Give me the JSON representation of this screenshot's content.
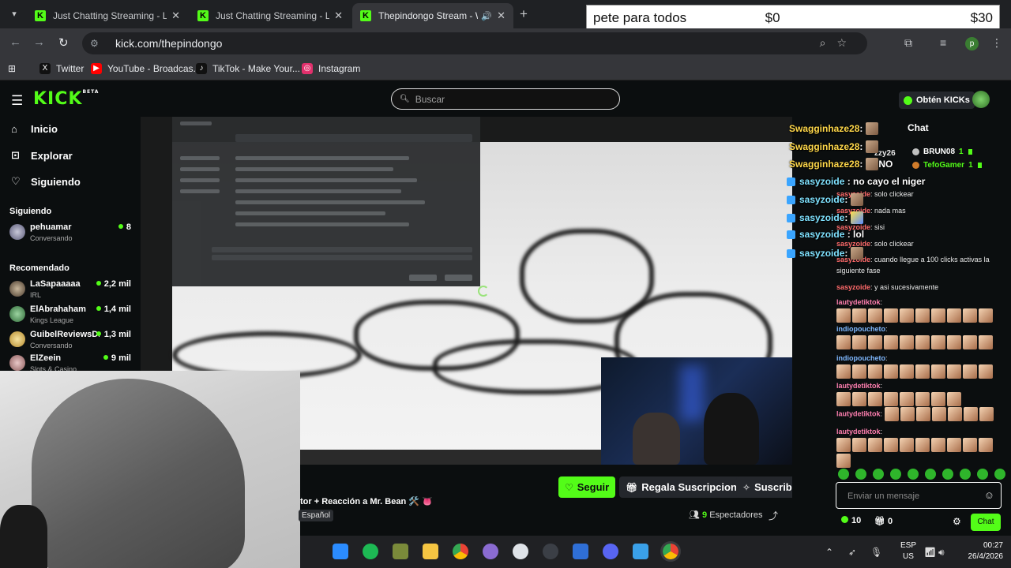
{
  "tabs": [
    {
      "title": "Just Chatting Streaming - Live S"
    },
    {
      "title": "Just Chatting Streaming - Live S"
    },
    {
      "title": "Thepindongo Stream - Watc"
    }
  ],
  "counter": {
    "name": "pete para todos",
    "value1": "$0",
    "value2": "$30"
  },
  "address": {
    "url": "kick.com/thepindongo"
  },
  "profile_initial": "p",
  "bookmarks": [
    {
      "label": "Twitter",
      "color": "#111111"
    },
    {
      "label": "YouTube - Broadcas...",
      "color": "#ff0000"
    },
    {
      "label": "TikTok - Make Your...",
      "color": "#111111"
    },
    {
      "label": "Instagram",
      "color": "#e1306c"
    }
  ],
  "kick": {
    "logo": "KICK",
    "logo_beta": "BETA",
    "search_placeholder": "Buscar",
    "kicks_button": "Obtén KICKs"
  },
  "sidebar": {
    "nav": [
      {
        "label": "Inicio",
        "icon": "home-icon"
      },
      {
        "label": "Explorar",
        "icon": "compass-icon"
      },
      {
        "label": "Siguiendo",
        "icon": "heart-icon"
      }
    ],
    "following_header": "Siguiendo",
    "following": [
      {
        "name": "pehuamar",
        "category": "Conversando",
        "viewers": "8"
      }
    ],
    "recommended_header": "Recomendado",
    "recommended": [
      {
        "name": "LaSapaaaaa",
        "category": "IRL",
        "viewers": "2,2 mil"
      },
      {
        "name": "ElAbrahaham",
        "category": "Kings League",
        "viewers": "1,4 mil"
      },
      {
        "name": "GuibelReviewsD...",
        "category": "Conversando",
        "viewers": "1,3 mil"
      },
      {
        "name": "ElZeein",
        "category": "Slots & Casino",
        "viewers": "9 mil"
      }
    ]
  },
  "stream": {
    "title": "tor + Reacción a Mr. Bean 🛠️ 👅",
    "language": "Español",
    "follow": "Seguir",
    "gift": "Regala Suscripciones",
    "subscribe": "Suscribirse",
    "viewers_count": "9",
    "viewers_label": "Espectadores"
  },
  "overlay_chat": [
    {
      "user": "Swagginhaze28",
      "text": ""
    },
    {
      "user": "Swagginhaze28",
      "text": ""
    },
    {
      "user": "Swagginhaze28",
      "text": "NO"
    },
    {
      "user": "sasyzoide",
      "text": "no cayo el niger"
    },
    {
      "user": "sasyzoide",
      "text": ""
    },
    {
      "user": "sasyzoide",
      "text": ""
    },
    {
      "user": "sasyzoide",
      "text": "lol"
    },
    {
      "user": "sasyzoide",
      "text": ""
    }
  ],
  "chat": {
    "title": "Chat",
    "pinned": [
      {
        "name": "BRUN08",
        "count": "1"
      },
      {
        "name": "TefoGamer",
        "count": "1"
      }
    ],
    "partial_user": "zzy26",
    "messages": [
      {
        "user": "sasyzoide",
        "text": "solo clickear"
      },
      {
        "user": "sasyzoide",
        "text": "nada mas"
      },
      {
        "user": "sasyzoide",
        "text": "sisi"
      },
      {
        "user": "sasyzoide",
        "text": "solo clickear"
      },
      {
        "user": "sasyzoide",
        "text": "cuando llegue a 100 clicks activas la siguiente fase"
      },
      {
        "user": "sasyzoide",
        "text": "y asi sucesivamente"
      },
      {
        "user": "lautydetiktok",
        "text": ""
      },
      {
        "user": "indiopoucheto",
        "text": ""
      },
      {
        "user": "indiopoucheto",
        "text": ""
      },
      {
        "user": "lautydetiktok",
        "text": ""
      },
      {
        "user": "lautydetiktok",
        "text": ""
      },
      {
        "user": "lautydetiktok",
        "text": ""
      }
    ],
    "input_placeholder": "Enviar un mensaje",
    "kicks_count": "10",
    "gift_count": "0",
    "send_label": "Chat"
  },
  "taskbar": {
    "lang_top": "ESP",
    "lang_bottom": "US",
    "time": "00:27",
    "date": "26/4/2026"
  }
}
